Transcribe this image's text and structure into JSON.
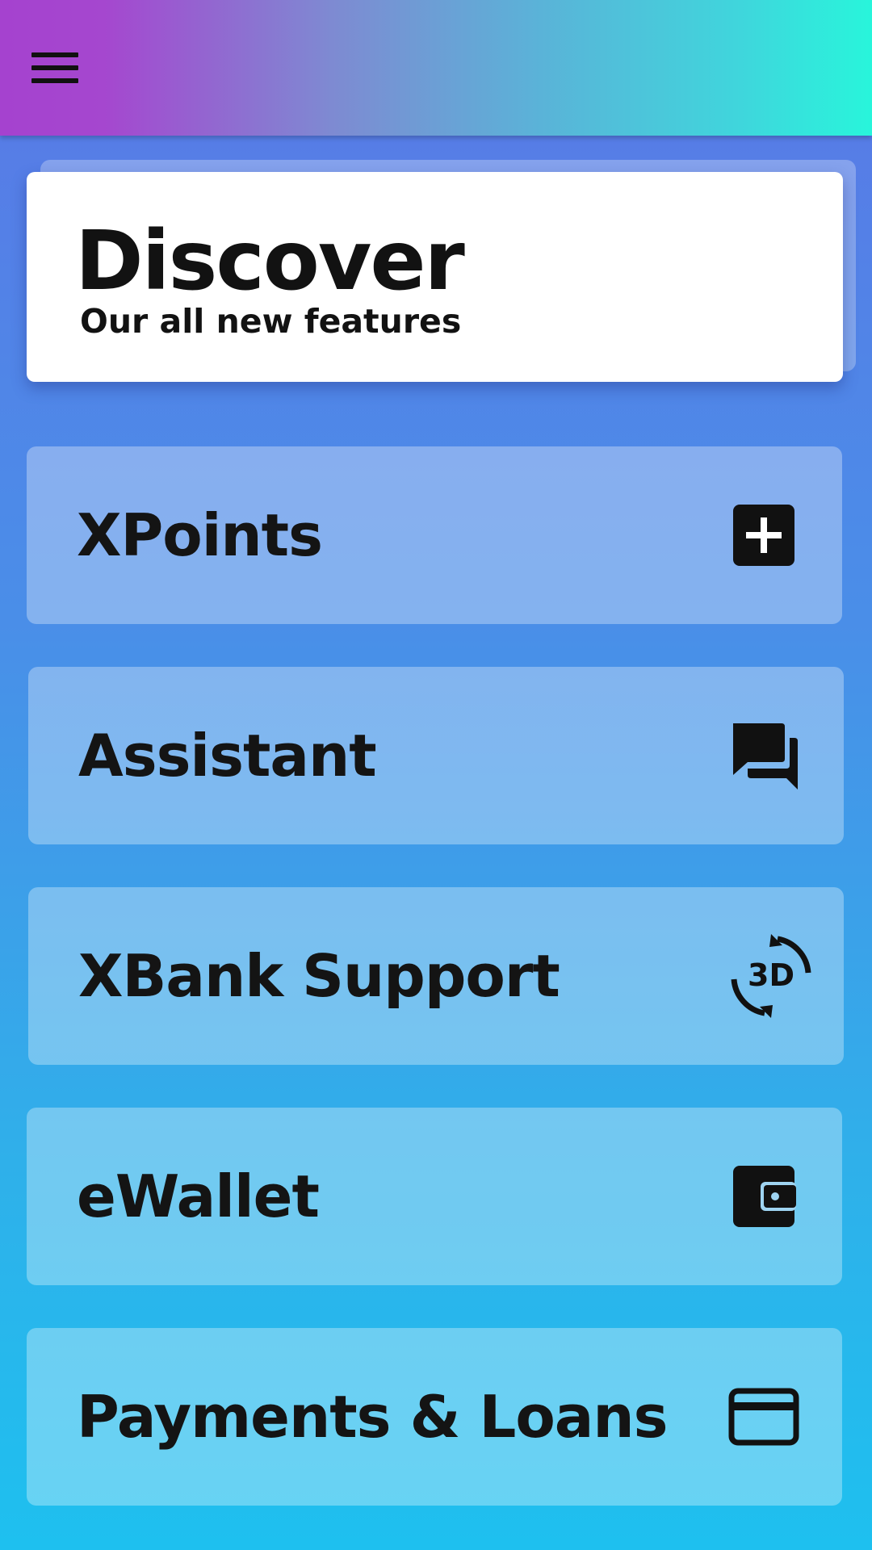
{
  "app_bar": {
    "menu_icon": "hamburger-menu-icon",
    "gradient": [
      "#a542cf",
      "#28f5db"
    ]
  },
  "discover": {
    "title": "Discover",
    "subtitle": "Our all new features"
  },
  "features": [
    {
      "label": "XPoints",
      "icon": "plus-box-icon"
    },
    {
      "label": "Assistant",
      "icon": "chat-bubbles-icon"
    },
    {
      "label": "XBank Support",
      "icon": "3d-rotation-icon"
    },
    {
      "label": "eWallet",
      "icon": "wallet-icon"
    },
    {
      "label": "Payments & Loans",
      "icon": "credit-card-icon"
    }
  ],
  "colors": {
    "text": "#121212",
    "background_top": "#5a78e6",
    "background_bottom": "#1ec0ef"
  }
}
